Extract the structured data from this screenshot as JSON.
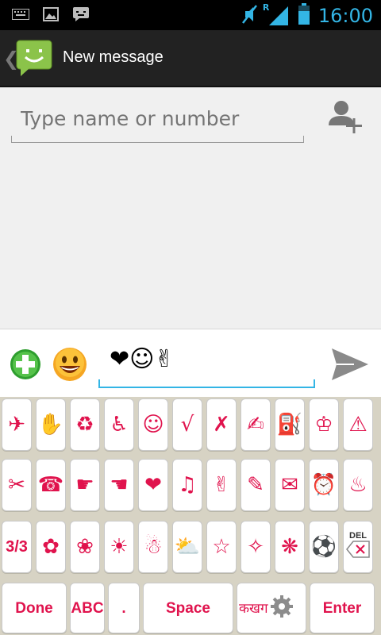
{
  "status_bar": {
    "time": "16:00",
    "left_icons": [
      "keyboard-icon",
      "image-icon",
      "message-icon"
    ],
    "right_icons": [
      "mute-icon",
      "roaming-signal-icon",
      "battery-icon"
    ],
    "roaming_label": "R"
  },
  "action_bar": {
    "title": "New message",
    "back_glyph": "❮",
    "logo": "messaging-app-icon"
  },
  "recipient": {
    "placeholder": "Type name or number",
    "value": ""
  },
  "compose": {
    "message": "❤☺✌",
    "attach_icon": "add-attachment-icon",
    "smiley_icon": "emoji-face-icon",
    "send_icon": "send-icon"
  },
  "keyboard": {
    "accent_color": "#e0134d",
    "rows": [
      [
        "✈",
        "✋",
        "♻",
        "♿",
        "☺",
        "√",
        "✗",
        "✍",
        "⛽",
        "♔",
        "⚠"
      ],
      [
        "✂",
        "☎",
        "☛",
        "☚",
        "❤",
        "♫",
        "✌",
        "✎",
        "✉",
        "⏰",
        "♨"
      ],
      [
        "3/3",
        "✿",
        "❀",
        "☀",
        "☃",
        "⛅",
        "☆",
        "✧",
        "❋",
        "⚽",
        "DEL"
      ]
    ],
    "bottom_row": {
      "done": "Done",
      "abc": "ABC",
      "period": ".",
      "space": "Space",
      "hindi": "कखग",
      "settings_icon": "gear-icon",
      "enter": "Enter"
    }
  }
}
